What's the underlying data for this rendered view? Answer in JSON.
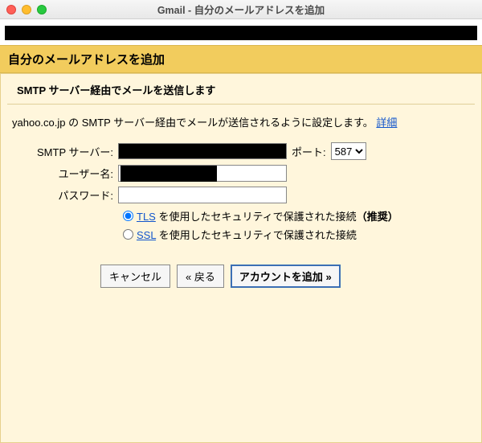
{
  "window": {
    "title": "Gmail - 自分のメールアドレスを追加"
  },
  "heading": "自分のメールアドレスを追加",
  "section_title": "SMTP サーバー経由でメールを送信します",
  "instruction_prefix": "yahoo.co.jp の SMTP サーバー経由でメールが送信されるように設定します。 ",
  "instruction_link": "詳細",
  "form": {
    "smtp_label": "SMTP サーバー:",
    "port_label": "ポート:",
    "port_value": "587",
    "username_label": "ユーザー名:",
    "password_label": "パスワード:",
    "password_value": ""
  },
  "security": {
    "tls_link": "TLS",
    "tls_suffix": " を使用したセキュリティで保護された接続",
    "tls_recommended": "（推奨）",
    "ssl_link": "SSL",
    "ssl_suffix": " を使用したセキュリティで保護された接続",
    "selected": "tls"
  },
  "buttons": {
    "cancel": "キャンセル",
    "back": "« 戻る",
    "add": "アカウントを追加 »"
  }
}
